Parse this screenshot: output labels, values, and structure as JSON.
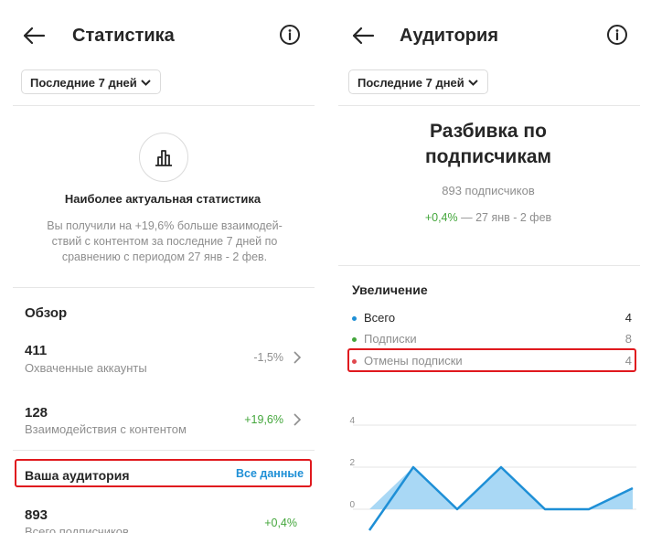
{
  "left": {
    "header_title": "Статистика",
    "range_label": "Последние 7 дней",
    "insight_title": "Наиболее актуальная статистика",
    "insight_lines": [
      "Вы получили на +19,6% больше взаимодей-",
      "ствий с контентом за последние 7 дней по",
      "сравнению с периодом 27 янв - 2 фев."
    ],
    "overview_title": "Обзор",
    "stats": [
      {
        "value": "411",
        "label": "Охваченные аккаунты",
        "change": "-1,5%",
        "change_color": "#8e8e8e"
      },
      {
        "value": "128",
        "label": "Взаимодействия с контентом",
        "change": "+19,6%",
        "change_color": "#43a63b"
      }
    ],
    "audience_title": "Ваша аудитория",
    "audience_link": "Все данные",
    "followers_value": "893",
    "followers_label": "Всего подписчиков",
    "followers_change": "+0,4%"
  },
  "right": {
    "header_title": "Аудитория",
    "range_label": "Последние 7 дней",
    "title_line1": "Разбивка по",
    "title_line2": "подписчикам",
    "followers_count": "893 подписчиков",
    "growth_pct": "+0,4%",
    "growth_period": " — 27 янв - 2 фев",
    "increase_title": "Увеличение",
    "legend": [
      {
        "label": "Всего",
        "value": "4",
        "color": "#1e8fd6"
      },
      {
        "label": "Подписки",
        "value": "8",
        "color": "#43a63b"
      },
      {
        "label": "Отмены подписки",
        "value": "4",
        "color": "#e0484e"
      }
    ]
  },
  "colors": {
    "accent_blue": "#1e8fd6",
    "positive_green": "#43a63b",
    "highlight_red": "#e0191e",
    "chart_line": "#1e8fd6",
    "chart_fill": "#a9d8f5"
  },
  "chart_data": {
    "type": "area",
    "title": "",
    "xlabel": "",
    "ylabel": "",
    "y_ticks": [
      "4",
      "2",
      "0"
    ],
    "ylim": [
      -1,
      4
    ],
    "grid": true,
    "series": [
      {
        "values": [
          -1,
          2,
          0,
          2,
          0,
          0,
          1
        ]
      }
    ]
  }
}
